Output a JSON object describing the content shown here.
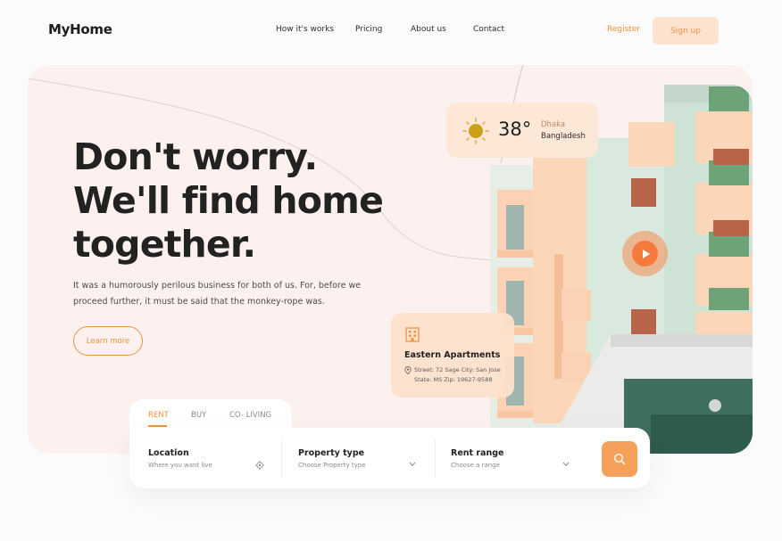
{
  "brand": {
    "logo": "MyHome"
  },
  "nav": {
    "links": [
      "How it's works",
      "Pricing",
      "About us",
      "Contact"
    ],
    "register": "Register",
    "signup": "Sign up"
  },
  "hero": {
    "headline": [
      "Don't worry.",
      "We'll find home",
      "together."
    ],
    "subtext": "It was a humorously perilous business for both of us. For, before we proceed further, it must be said that the monkey-rope was.",
    "cta": "Learn more"
  },
  "weather": {
    "temp": "38°",
    "city": "Dhaka",
    "country": "Bangladesh",
    "icon": "sun-icon"
  },
  "listing": {
    "title": "Eastern Apartments",
    "address_line1": "Street: 72 Sage City: San Jose",
    "address_line2": "State: MS Zip: 19627-9588"
  },
  "search": {
    "tabs": [
      "RENT",
      "BUY",
      "CO- LIVING"
    ],
    "active_tab": "RENT",
    "fields": [
      {
        "label": "Location",
        "value": "Where you want live",
        "icon": "locate-icon"
      },
      {
        "label": "Property type",
        "value": "Choose Property type",
        "icon": "chevron-down-icon"
      },
      {
        "label": "Rent range",
        "value": "Choose a range",
        "icon": "chevron-down-icon"
      }
    ],
    "button_icon": "search-icon"
  },
  "colors": {
    "accent": "#f2913f",
    "hero_bg": "#fdf1ef",
    "card_bg": "#fde1cc"
  }
}
